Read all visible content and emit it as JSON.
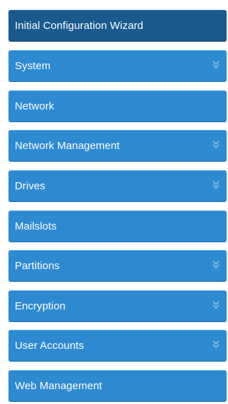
{
  "menu": {
    "items": [
      {
        "id": "initial-configuration-wizard",
        "label": "Initial Configuration Wizard",
        "expandable": false,
        "active": true
      },
      {
        "id": "system",
        "label": "System",
        "expandable": true,
        "active": false
      },
      {
        "id": "network",
        "label": "Network",
        "expandable": false,
        "active": false
      },
      {
        "id": "network-management",
        "label": "Network Management",
        "expandable": true,
        "active": false
      },
      {
        "id": "drives",
        "label": "Drives",
        "expandable": true,
        "active": false
      },
      {
        "id": "mailslots",
        "label": "Mailslots",
        "expandable": false,
        "active": false
      },
      {
        "id": "partitions",
        "label": "Partitions",
        "expandable": true,
        "active": false
      },
      {
        "id": "encryption",
        "label": "Encryption",
        "expandable": true,
        "active": false
      },
      {
        "id": "user-accounts",
        "label": "User Accounts",
        "expandable": true,
        "active": false
      },
      {
        "id": "web-management",
        "label": "Web Management",
        "expandable": false,
        "active": false
      }
    ],
    "expand_icon": "double-chevron-down-icon",
    "colors": {
      "item_bg": "#2e8ad0",
      "active_bg": "#1a5a8e",
      "text": "#ffffff",
      "chevron": "#8cc4ee"
    }
  }
}
